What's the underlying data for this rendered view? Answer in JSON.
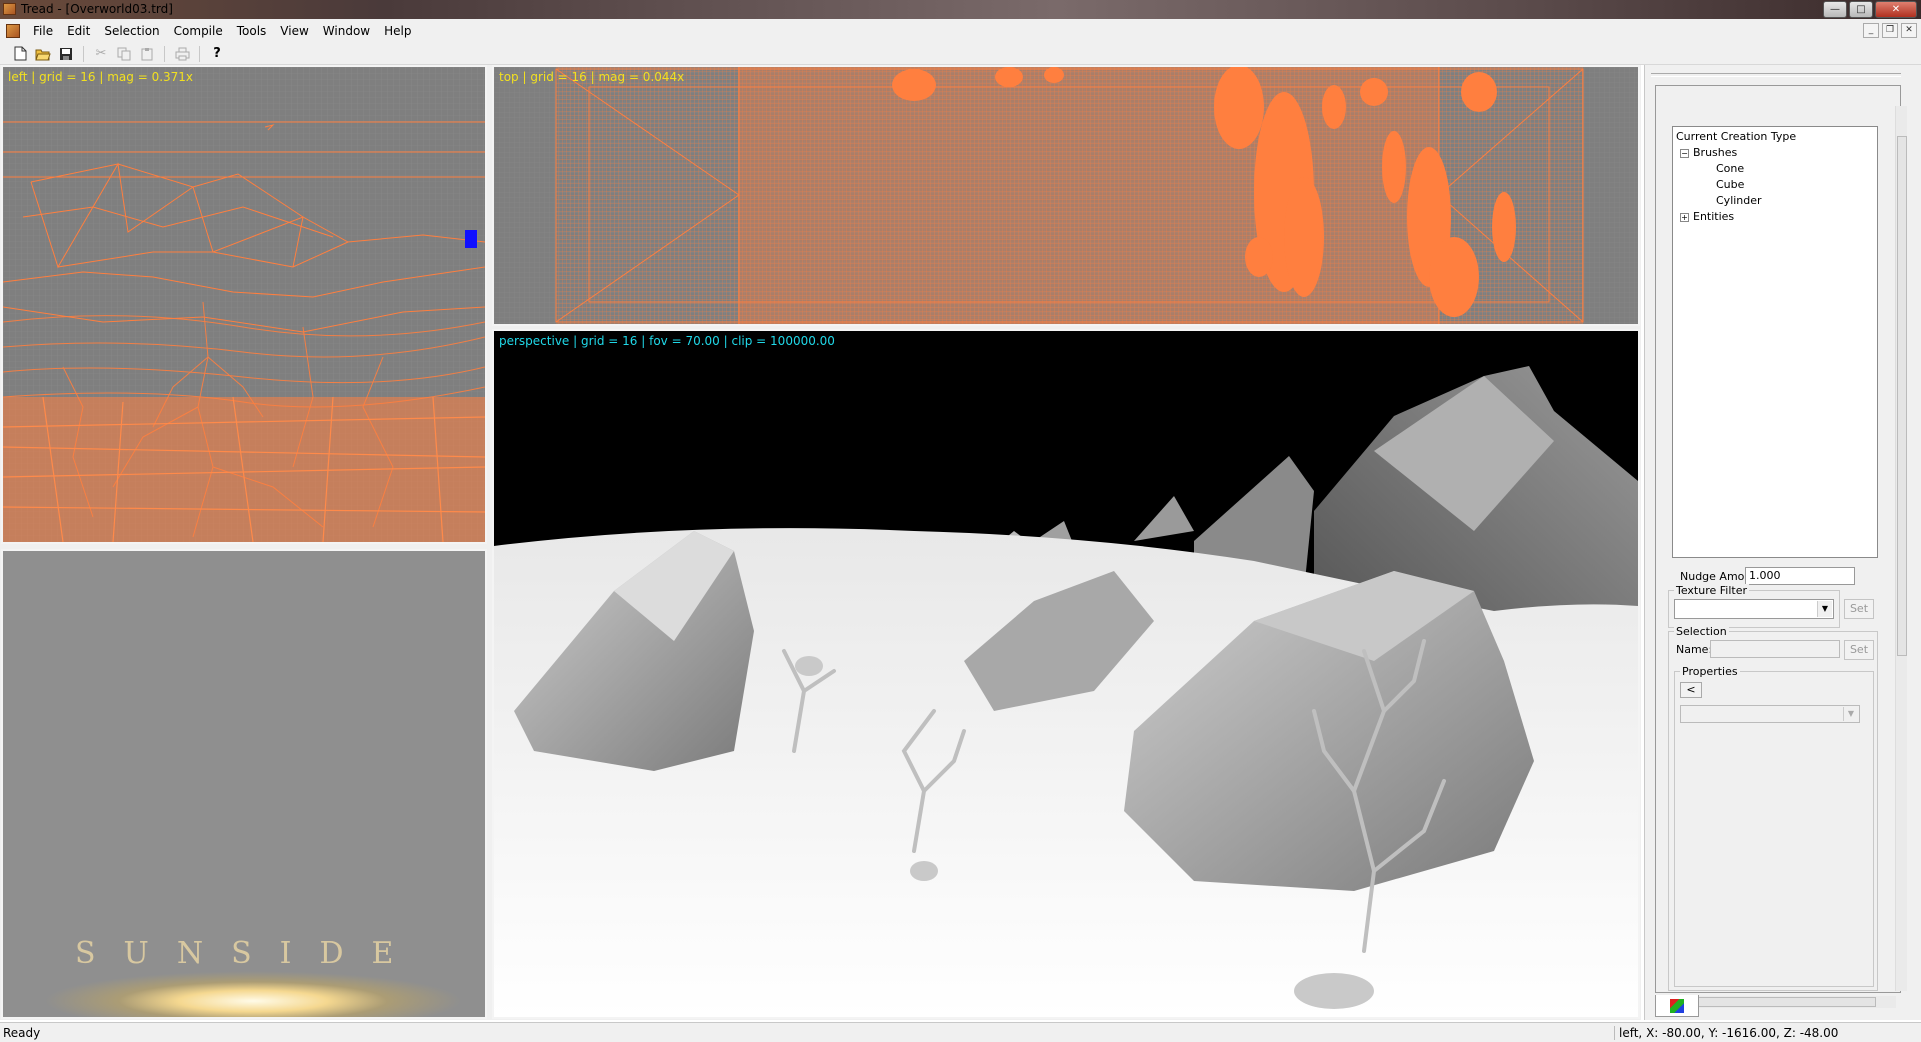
{
  "window": {
    "title": "Tread - [Overworld03.trd]",
    "app_icon": "tread-app-icon",
    "controls": [
      "minimize-icon",
      "maximize-icon",
      "close-icon"
    ]
  },
  "menu": {
    "items": [
      {
        "label": "File"
      },
      {
        "label": "Edit"
      },
      {
        "label": "Selection"
      },
      {
        "label": "Compile"
      },
      {
        "label": "Tools"
      },
      {
        "label": "View"
      },
      {
        "label": "Window"
      },
      {
        "label": "Help"
      }
    ]
  },
  "toolbar": {
    "buttons": [
      {
        "icon": "new-file-icon",
        "enabled": true
      },
      {
        "icon": "open-folder-icon",
        "enabled": true
      },
      {
        "icon": "save-icon",
        "enabled": true
      },
      {
        "icon": "cut-icon",
        "enabled": false
      },
      {
        "icon": "copy-icon",
        "enabled": false
      },
      {
        "icon": "paste-icon",
        "enabled": false
      },
      {
        "icon": "print-icon",
        "enabled": false
      },
      {
        "icon": "help-icon",
        "enabled": true
      }
    ]
  },
  "viewports": {
    "left": {
      "label": "left | grid = 16 | mag = 0.371x",
      "color": "#f2e020"
    },
    "top": {
      "label": "top | grid = 16 | mag = 0.044x",
      "color": "#f2e020"
    },
    "perspective": {
      "label": "perspective | grid = 16 | fov = 70.00 | clip = 100000.00",
      "color": "#20d8e8"
    },
    "logo": {
      "text": "SUNSIDE"
    },
    "wireframe_color": "#ff7f3f",
    "selection_color": "#1010ff"
  },
  "panel": {
    "tree": {
      "root": "Current Creation Type",
      "groups": [
        {
          "label": "Brushes",
          "expanded": true,
          "children": [
            "Cone",
            "Cube",
            "Cylinder"
          ]
        },
        {
          "label": "Entities",
          "expanded": false,
          "children": []
        }
      ]
    },
    "nudge": {
      "label": "Nudge Amount:",
      "value": "1.000"
    },
    "texture_filter": {
      "title": "Texture Filter",
      "value": "",
      "set_label": "Set"
    },
    "selection": {
      "title": "Selection",
      "name_label": "Name:",
      "name_value": "",
      "set_label": "Set",
      "properties_title": "Properties",
      "back_label": "<",
      "property_value": ""
    },
    "tab_icon": "color-palette-icon"
  },
  "status": {
    "text": "Ready",
    "coords": "left, X: -80.00, Y: -1616.00, Z: -48.00"
  }
}
